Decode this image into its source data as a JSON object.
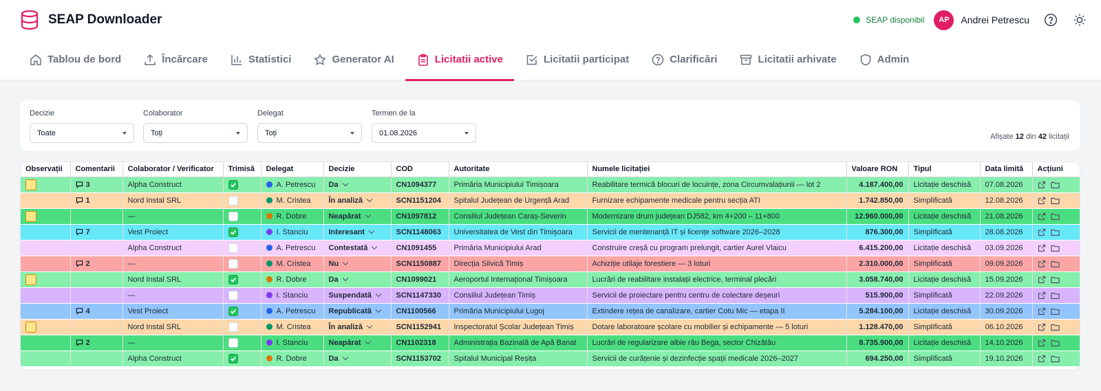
{
  "app": {
    "title": "SEAP Downloader",
    "status": "SEAP disponibil",
    "user_initials": "AP",
    "user_name": "Andrei Petrescu"
  },
  "tabs": [
    {
      "label": "Tablou de bord",
      "icon": "home-icon"
    },
    {
      "label": "Încărcare",
      "icon": "upload-icon"
    },
    {
      "label": "Statistici",
      "icon": "bar-chart-icon"
    },
    {
      "label": "Generator AI",
      "icon": "star-icon"
    },
    {
      "label": "Licitatii active",
      "icon": "clipboard-icon",
      "active": true
    },
    {
      "label": "Licitatii participat",
      "icon": "checkbox-icon"
    },
    {
      "label": "Clarificări",
      "icon": "question-icon"
    },
    {
      "label": "Licitatii arhivate",
      "icon": "archive-icon"
    },
    {
      "label": "Admin",
      "icon": "shield-icon"
    }
  ],
  "filters": {
    "decizie": {
      "label": "Decizie",
      "value": "Toate"
    },
    "colaborator": {
      "label": "Colaborator",
      "value": "Toți"
    },
    "delegat": {
      "label": "Delegat",
      "value": "Toți"
    },
    "termen": {
      "label": "Termen de la",
      "value": "01.08.2026"
    },
    "count_prefix": "Afișate",
    "count_shown": "12",
    "count_mid": "din",
    "count_total": "42",
    "count_suffix": "licitații"
  },
  "table": {
    "columns": [
      "Observații",
      "Comentarii",
      "Colaborator / Verificator",
      "Trimisă",
      "Delegat",
      "Decizie",
      "COD",
      "Autoritate",
      "Numele licitației",
      "Valoare RON",
      "Tipul",
      "Data limită",
      "Acțiuni"
    ],
    "rows": [
      {
        "color": "green",
        "note": true,
        "comments": "3",
        "collab": "Alpha Construct",
        "sent": true,
        "delegat": "A. Petrescu",
        "dot": "#2563eb",
        "decision": "Da",
        "cod": "CN1094377",
        "authority": "Primăria Municipiului Timișoara",
        "name": "Reabilitare termică blocuri de locuințe, zona Circumvalațiunii — lot 2",
        "value": "4.187.400,00",
        "type": "Licitație deschisă",
        "deadline": "07.08.2026"
      },
      {
        "color": "orange",
        "note": false,
        "comments": "1",
        "collab": "Nord Instal SRL",
        "sent": false,
        "delegat": "M. Cristea",
        "dot": "#059669",
        "decision": "În analiză",
        "cod": "SCN1151204",
        "authority": "Spitalul Județean de Urgență Arad",
        "name": "Furnizare echipamente medicale pentru secția ATI",
        "value": "1.742.850,00",
        "type": "Simplificată",
        "deadline": "12.08.2026"
      },
      {
        "color": "dgreen",
        "note": true,
        "comments": "",
        "collab": "—",
        "sent": false,
        "delegat": "R. Dobre",
        "dot": "#d97706",
        "decision": "Neapărat",
        "cod": "CN1097812",
        "authority": "Consiliul Județean Caraș-Severin",
        "name": "Modernizare drum județean DJ582, km 4+200 – 11+800",
        "value": "12.960.000,00",
        "type": "Licitație deschisă",
        "deadline": "21.08.2026"
      },
      {
        "color": "cyan",
        "note": false,
        "comments": "7",
        "collab": "Vest Proiect",
        "sent": true,
        "delegat": "I. Stanciu",
        "dot": "#7c3aed",
        "decision": "Interesant",
        "cod": "SCN1148063",
        "authority": "Universitatea de Vest din Timișoara",
        "name": "Servicii de mentenanță IT și licențe software 2026–2028",
        "value": "876.300,00",
        "type": "Simplificată",
        "deadline": "28.08.2026"
      },
      {
        "color": "pink",
        "note": false,
        "comments": "",
        "collab": "Alpha Construct",
        "sent": false,
        "delegat": "A. Petrescu",
        "dot": "#2563eb",
        "decision": "Contestată",
        "cod": "CN1091455",
        "authority": "Primăria Municipiului Arad",
        "name": "Construire creșă cu program prelungit, cartier Aurel Vlaicu",
        "value": "6.415.200,00",
        "type": "Licitație deschisă",
        "deadline": "03.09.2026"
      },
      {
        "color": "red",
        "note": false,
        "comments": "2",
        "collab": "—",
        "sent": false,
        "delegat": "M. Cristea",
        "dot": "#059669",
        "decision": "Nu",
        "cod": "SCN1150887",
        "authority": "Direcția Silvică Timiș",
        "name": "Achiziție utilaje forestiere — 3 loturi",
        "value": "2.310.000,00",
        "type": "Simplificată",
        "deadline": "09.09.2026"
      },
      {
        "color": "green",
        "note": true,
        "comments": "",
        "collab": "Nord Instal SRL",
        "sent": true,
        "delegat": "R. Dobre",
        "dot": "#d97706",
        "decision": "Da",
        "cod": "CN1099021",
        "authority": "Aeroportul Internațional Timișoara",
        "name": "Lucrări de reabilitare instalații electrice, terminal plecări",
        "value": "3.058.740,00",
        "type": "Licitație deschisă",
        "deadline": "15.09.2026"
      },
      {
        "color": "purple",
        "note": false,
        "comments": "",
        "collab": "—",
        "sent": false,
        "delegat": "I. Stanciu",
        "dot": "#7c3aed",
        "decision": "Suspendată",
        "cod": "SCN1147330",
        "authority": "Consiliul Județean Timiș",
        "name": "Servicii de proiectare pentru centru de colectare deșeuri",
        "value": "515.900,00",
        "type": "Simplificată",
        "deadline": "22.09.2026"
      },
      {
        "color": "blue",
        "note": false,
        "comments": "4",
        "collab": "Vest Proiect",
        "sent": true,
        "delegat": "A. Petrescu",
        "dot": "#2563eb",
        "decision": "Republicată",
        "cod": "CN1100566",
        "authority": "Primăria Municipiului Lugoj",
        "name": "Extindere rețea de canalizare, cartier Cotu Mic — etapa II",
        "value": "5.284.100,00",
        "type": "Licitație deschisă",
        "deadline": "30.09.2026"
      },
      {
        "color": "orange",
        "note": true,
        "comments": "",
        "collab": "Nord Instal SRL",
        "sent": false,
        "delegat": "M. Cristea",
        "dot": "#059669",
        "decision": "În analiză",
        "cod": "SCN1152941",
        "authority": "Inspectoratul Școlar Județean Timiș",
        "name": "Dotare laboratoare școlare cu mobilier și echipamente — 5 loturi",
        "value": "1.128.470,00",
        "type": "Simplificată",
        "deadline": "06.10.2026"
      },
      {
        "color": "dgreen",
        "note": false,
        "comments": "2",
        "collab": "—",
        "sent": false,
        "delegat": "I. Stanciu",
        "dot": "#7c3aed",
        "decision": "Neapărat",
        "cod": "CN1102318",
        "authority": "Administrația Bazinală de Apă Banat",
        "name": "Lucrări de regularizare albie râu Bega, sector Chizătău",
        "value": "8.735.900,00",
        "type": "Licitație deschisă",
        "deadline": "14.10.2026"
      },
      {
        "color": "green",
        "note": false,
        "comments": "",
        "collab": "Alpha Construct",
        "sent": true,
        "delegat": "R. Dobre",
        "dot": "#d97706",
        "decision": "Da",
        "cod": "SCN1153702",
        "authority": "Spitalul Municipal Reșița",
        "name": "Servicii de curățenie și dezinfecție spații medicale 2026–2027",
        "value": "694.250,00",
        "type": "Simplificată",
        "deadline": "19.10.2026"
      }
    ]
  }
}
